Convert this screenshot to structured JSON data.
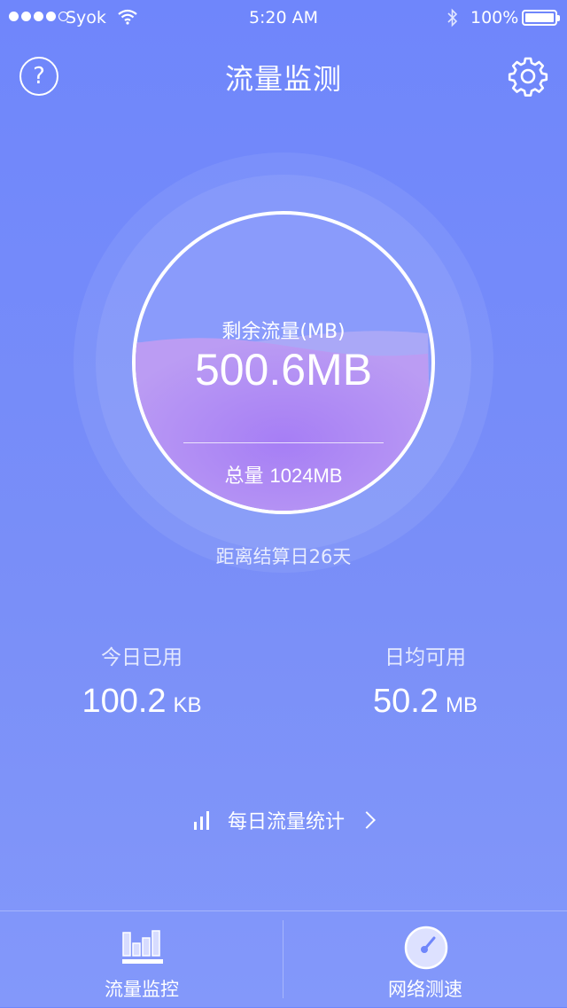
{
  "status_bar": {
    "carrier": "Syok",
    "time": "5:20 AM",
    "battery": "100%",
    "signal_bars_filled": 4,
    "signal_bars_total": 5
  },
  "header": {
    "title": "流量监测",
    "help_icon_glyph": "?",
    "help_icon": "question-circle-icon",
    "settings_icon": "gear-icon"
  },
  "gauge": {
    "remaining_label": "剩余流量(MB)",
    "remaining_value": "500.6MB",
    "total_prefix": "总量",
    "total_value": "1024MB",
    "fill_fraction": 0.49,
    "countdown": "距离结算日26天"
  },
  "stats": {
    "today_used_label": "今日已用",
    "today_used_value": "100.2",
    "today_used_unit": "KB",
    "daily_avail_label": "日均可用",
    "daily_avail_value": "50.2",
    "daily_avail_unit": "MB"
  },
  "daily_link": {
    "label": "每日流量统计",
    "icon": "bar-chart-icon"
  },
  "tabbar": {
    "tabs": [
      {
        "label": "流量监控",
        "icon": "traffic-monitor-icon"
      },
      {
        "label": "网络测速",
        "icon": "speedometer-icon"
      }
    ]
  },
  "colors": {
    "background": "#7088fb",
    "water": "#a582f5",
    "white": "#ffffff"
  }
}
